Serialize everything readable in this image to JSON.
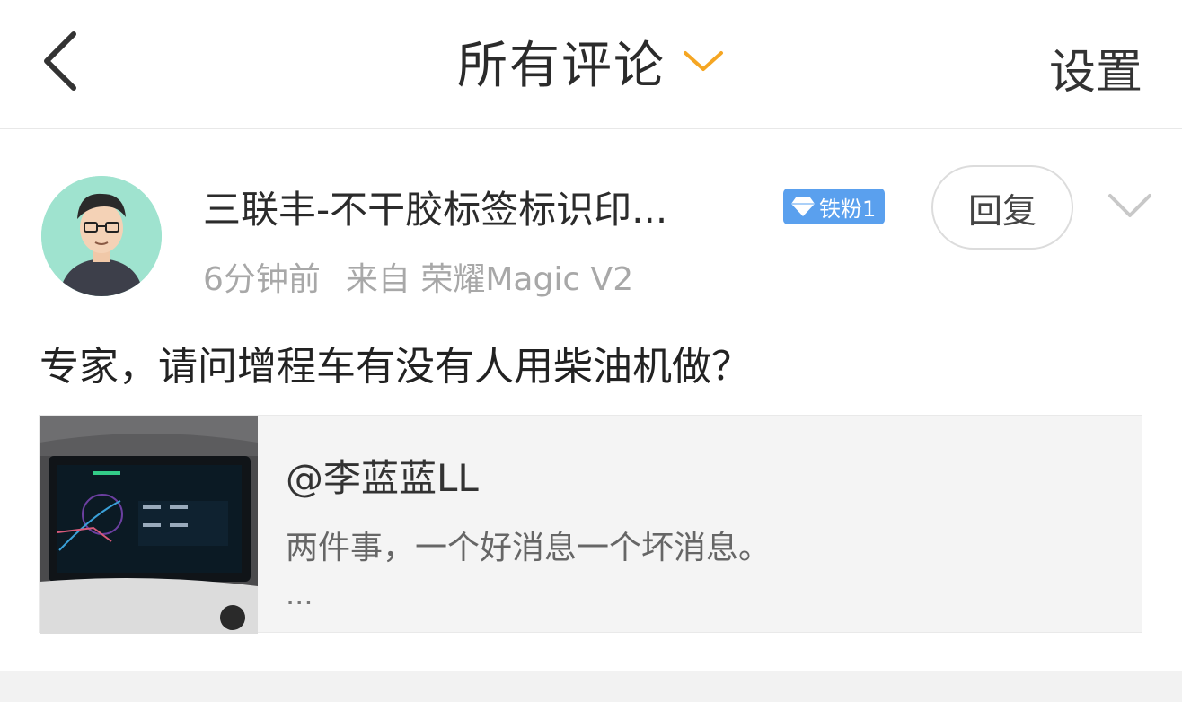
{
  "header": {
    "title": "所有评论",
    "settings_label": "设置"
  },
  "comment": {
    "username": "三联丰-不干胶标签标识印...",
    "badge_label": "铁粉1",
    "time": "6分钟前",
    "source": "来自 荣耀Magic V2",
    "reply_label": "回复",
    "text": "专家，请问增程车有没有人用柴油机做？"
  },
  "quote": {
    "user": "@李蓝蓝LL",
    "text": "两件事，一个好消息一个坏消息。",
    "ellipsis": "..."
  },
  "colors": {
    "accent_orange": "#f5a623",
    "badge_blue": "#5aa0ee"
  },
  "icons": [
    "back-chevron-icon",
    "dropdown-chevron-icon",
    "diamond-icon",
    "more-chevron-icon"
  ]
}
